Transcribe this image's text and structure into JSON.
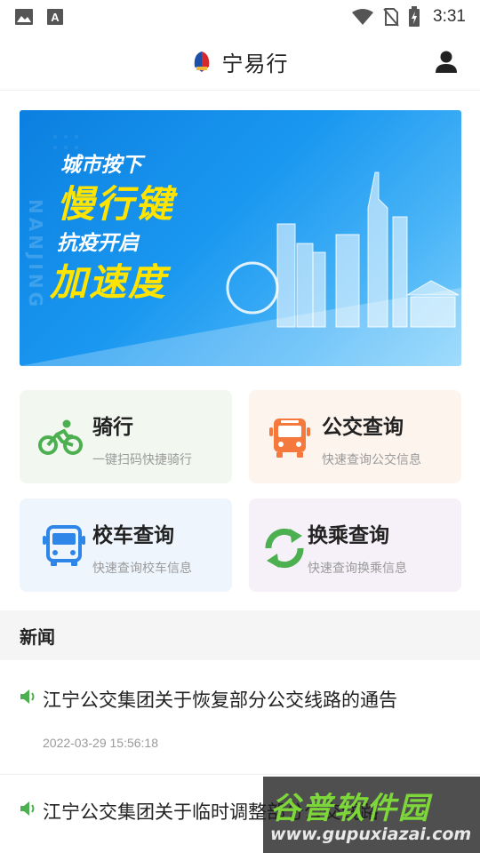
{
  "statusbar": {
    "left_icons": [
      "image-icon",
      "font-icon"
    ],
    "right_icons": [
      "wifi-icon",
      "no-sim-icon",
      "battery-charging-icon"
    ],
    "time": "3:31"
  },
  "header": {
    "title": "宁易行",
    "user_icon": "user-icon"
  },
  "banner": {
    "line1": "城市按下",
    "line2": "慢行键",
    "line3": "抗疫开启",
    "line4": "加速度",
    "vertical_text": "NANJING"
  },
  "cards": [
    {
      "name": "骑行",
      "desc": "一键扫码快捷骑行",
      "icon": "bicycle-icon",
      "color": "#4caf50"
    },
    {
      "name": "公交查询",
      "desc": "快速查询公交信息",
      "icon": "bus-icon",
      "color": "#f5783c"
    },
    {
      "name": "校车查询",
      "desc": "快速查询校车信息",
      "icon": "school-bus-icon",
      "color": "#2e86e8"
    },
    {
      "name": "换乘查询",
      "desc": "快速查询换乘信息",
      "icon": "transfer-icon",
      "color": "#4caf50"
    }
  ],
  "news": {
    "heading": "新闻",
    "items": [
      {
        "title": "江宁公交集团关于恢复部分公交线路的通告",
        "date": "2022-03-29 15:56:18"
      },
      {
        "title": "江宁公交集团关于临时调整部分公交线路",
        "date": ""
      }
    ]
  },
  "watermark": {
    "line1": "谷普软件园",
    "line2": "www.gupuxiazai.com"
  }
}
